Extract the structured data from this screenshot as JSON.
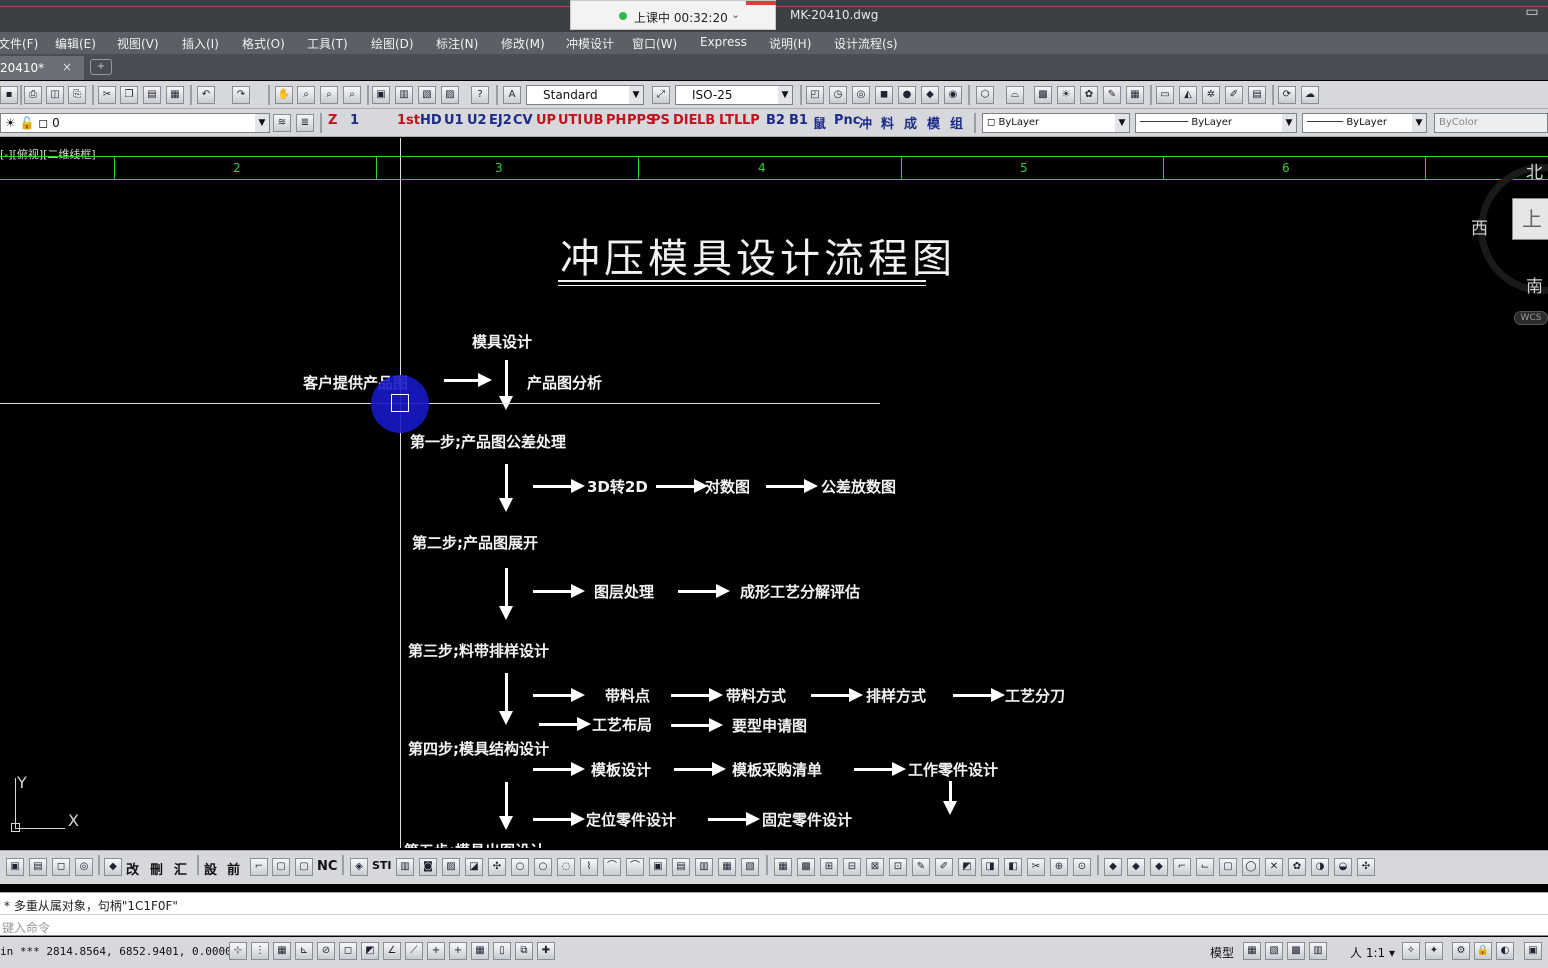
{
  "titlebar": {
    "live_status": "上课中 00:32:20",
    "live_chevron": "⌄",
    "doc_title": "MK-20410.dwg",
    "min_icon": "▭"
  },
  "menu": [
    "文件(F)",
    "编辑(E)",
    "视图(V)",
    "插入(I)",
    "格式(O)",
    "工具(T)",
    "绘图(D)",
    "标注(N)",
    "修改(M)",
    "冲模设计",
    "窗口(W)",
    "Express",
    "说明(H)",
    "设计流程(s)"
  ],
  "doc_tab": {
    "label": "20410*",
    "close": "×",
    "new": "+"
  },
  "toolbar1": {
    "text_style": "Standard",
    "dim_style": "ISO-25"
  },
  "toolbar2": {
    "layer_value": "0",
    "cad_icons": [
      "Z",
      "1",
      "1st",
      "HD",
      "U1",
      "U2",
      "EJ2",
      "CV",
      "UP",
      "UTI",
      "UB",
      "PH",
      "PPS",
      "PS",
      "DIE",
      "LB",
      "LTL",
      "LP",
      "B2",
      "B1",
      "鼠",
      "Pnc",
      "冲",
      "料",
      "成",
      "模",
      "组"
    ],
    "color_combo": "ByLayer",
    "linetype_combo": "ByLayer",
    "lineweight_combo": "ByLayer",
    "plotstyle_combo": "ByColor"
  },
  "viewport": {
    "label": "[-][俯视][二维线框]",
    "ruler_numbers": [
      "2",
      "3",
      "4",
      "5",
      "6"
    ]
  },
  "viewcube": {
    "north": "北",
    "west": "西",
    "south": "南",
    "face": "上",
    "wcs": "WCS"
  },
  "ucs": {
    "y": "Y",
    "x": "X"
  },
  "flowchart": {
    "title": "冲压模具设计流程图",
    "mold_design": "模具设计",
    "customer_drawing": "客户提供产品图",
    "product_analysis": "产品图分析",
    "step1": "第一步;产品图公差处理",
    "step1_items": [
      "3D转2D",
      "对数图",
      "公差放数图"
    ],
    "step2": "第二步;产品图展开",
    "step2_items": [
      "图层处理",
      "成形工艺分解评估"
    ],
    "step3": "第三步;料带排样设计",
    "step3_items": [
      "带料点",
      "带料方式",
      "排样方式",
      "工艺分刀"
    ],
    "step3_items_row2": [
      "工艺布局",
      "要型申请图"
    ],
    "step4": "第四步;模具结构设计",
    "step4_items": [
      "模板设计",
      "模板采购清单",
      "工作零件设计"
    ],
    "step4_items_row2": [
      "定位零件设计",
      "固定零件设计"
    ],
    "step5_partial": "第五步;模具出图设计"
  },
  "bottom_toolbar": {
    "labels": [
      "改",
      "刪",
      "汇",
      "設",
      "前",
      "NC",
      "STI"
    ]
  },
  "command": {
    "history": "* 多重从属对象，句柄\"1C1F0F\"",
    "prompt": "键入命令"
  },
  "status": {
    "coords": "in ***  2814.8564, 6852.9401, 0.0000",
    "model": "模型",
    "anno_scale": "人 1:1 ▾"
  },
  "colors": {
    "accent_green": "#2fd22f",
    "canvas_bg": "#000000",
    "cursor_blue": "#1718c8"
  }
}
